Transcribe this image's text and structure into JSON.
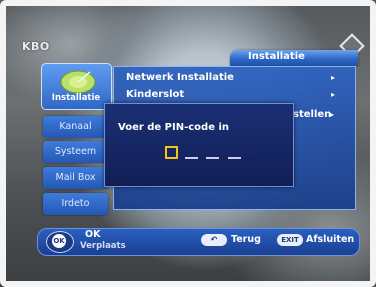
{
  "brand": {
    "logo_text": "KBO"
  },
  "header": {
    "title": "Installatie"
  },
  "left_tabs": {
    "active_label": "Installatie",
    "items": [
      "Kanaal",
      "Systeem",
      "Mail Box",
      "Irdeto"
    ]
  },
  "menu": {
    "items": [
      {
        "label": "Netwerk Installatie",
        "arrow": "▸"
      },
      {
        "label": "Kinderslot",
        "arrow": "▸"
      },
      {
        "label": "stellen",
        "arrow": "▸"
      }
    ]
  },
  "pin_dialog": {
    "prompt": "Voer de PIN-code in",
    "digits_entered": 0,
    "digits_total": 4
  },
  "footer": {
    "ok_button": "OK",
    "ok_label": "OK",
    "move_label": "Verplaats",
    "back_key": "↶",
    "back_label": "Terug",
    "exit_key": "EXIT",
    "exit_label": "Afsluiten"
  },
  "colors": {
    "accent_blue": "#2d68c9",
    "dialog_bg": "#1a2f74",
    "pin_highlight": "#f5c41a"
  }
}
